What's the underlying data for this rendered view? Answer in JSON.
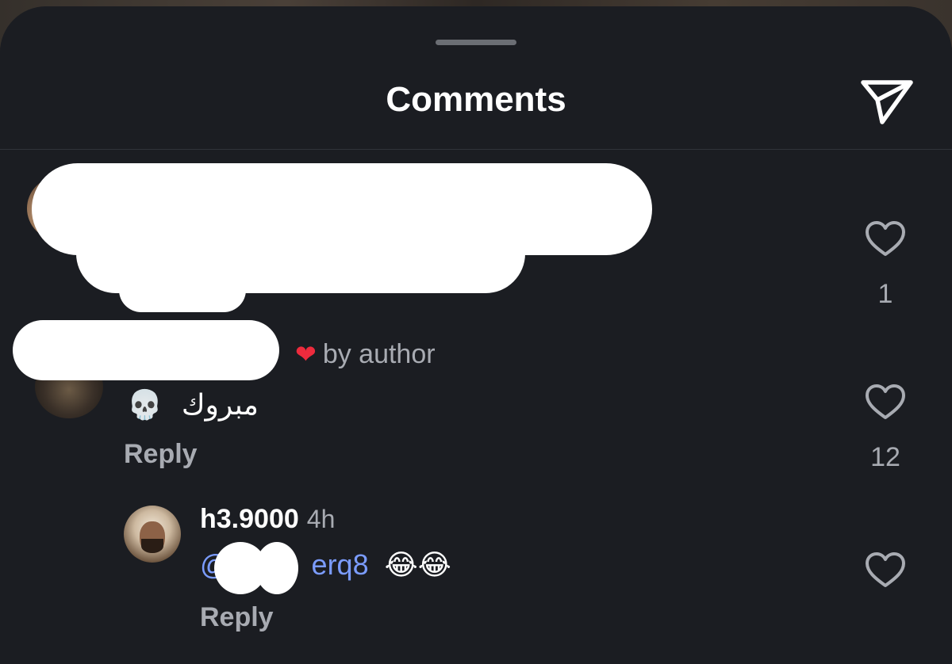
{
  "header": {
    "title": "Comments",
    "share_icon": "send-icon"
  },
  "comments": [
    {
      "likes": "1"
    },
    {
      "liked_by_author": "by author",
      "text": "مبروك",
      "emoji": "💀",
      "reply_label": "Reply",
      "likes": "12"
    },
    {
      "username": "h3.9000",
      "time": "4h",
      "mention_visible_start": "@",
      "mention_visible_end": "erq8",
      "emoji": "😂😂",
      "reply_label": "Reply"
    }
  ],
  "colors": {
    "sheet_background": "#1b1d22",
    "secondary_text": "#a8abb2",
    "mention": "#7b9cff",
    "author_heart": "#ed2b3d"
  }
}
